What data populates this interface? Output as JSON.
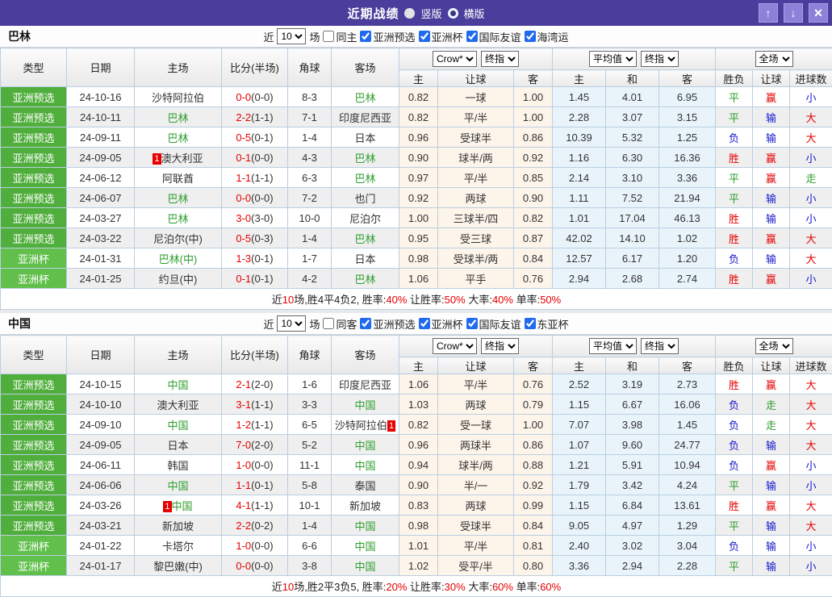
{
  "titlebar": {
    "title": "近期战绩",
    "vertical_label": "竖版",
    "horizontal_label": "横版",
    "up_icon": "↑",
    "down_icon": "↓",
    "close_icon": "✕"
  },
  "filter_labels": {
    "near": "近",
    "matches": "场"
  },
  "table_header": {
    "static_cols": [
      "类型",
      "日期",
      "主场",
      "比分(半场)",
      "角球",
      "客场"
    ],
    "group1_selects": [
      "Crow*",
      "终指"
    ],
    "group1_cols": [
      "主",
      "让球",
      "客"
    ],
    "group2_selects": [
      "平均值",
      "终指"
    ],
    "group2_cols": [
      "主",
      "和",
      "客"
    ],
    "group3_select": "全场",
    "group3_cols": [
      "胜负",
      "让球",
      "进球数"
    ]
  },
  "colors": {
    "titlebar_purple": "#4a3e9c",
    "type_green": "#50ae3c",
    "win_red": "#e60000",
    "loss_blue": "#1717cd",
    "draw_green": "#2e9e2e",
    "checkbox_blue": "#1f6bf0"
  },
  "sections": [
    {
      "team": "巴林",
      "filter": {
        "count": "10",
        "same": "同主",
        "same_checked": false,
        "competitions": [
          "亚洲预选",
          "亚洲杯",
          "国际友谊",
          "海湾运"
        ]
      },
      "rows": [
        {
          "type": "亚洲预选",
          "date": "24-10-16",
          "home": "沙特阿拉伯",
          "home_green": false,
          "score": "0-0",
          "half": "(0-0)",
          "corner": "8-3",
          "away": "巴林",
          "away_green": true,
          "odds1": [
            "0.82",
            "一球",
            "1.00"
          ],
          "odds2": [
            "1.45",
            "4.01",
            "6.95"
          ],
          "results": [
            "平",
            "赢",
            "小"
          ]
        },
        {
          "type": "亚洲预选",
          "date": "24-10-11",
          "home": "巴林",
          "home_green": true,
          "score": "2-2",
          "half": "(1-1)",
          "corner": "7-1",
          "away": "印度尼西亚",
          "away_green": false,
          "odds1": [
            "0.82",
            "平/半",
            "1.00"
          ],
          "odds2": [
            "2.28",
            "3.07",
            "3.15"
          ],
          "results": [
            "平",
            "输",
            "大"
          ]
        },
        {
          "type": "亚洲预选",
          "date": "24-09-11",
          "home": "巴林",
          "home_green": true,
          "score": "0-5",
          "half": "(0-1)",
          "corner": "1-4",
          "away": "日本",
          "away_green": false,
          "odds1": [
            "0.96",
            "受球半",
            "0.86"
          ],
          "odds2": [
            "10.39",
            "5.32",
            "1.25"
          ],
          "results": [
            "负",
            "输",
            "大"
          ]
        },
        {
          "type": "亚洲预选",
          "date": "24-09-05",
          "home": "澳大利亚",
          "home_green": false,
          "home_badge": "1",
          "score": "0-1",
          "half": "(0-0)",
          "corner": "4-3",
          "away": "巴林",
          "away_green": true,
          "odds1": [
            "0.90",
            "球半/两",
            "0.92"
          ],
          "odds2": [
            "1.16",
            "6.30",
            "16.36"
          ],
          "results": [
            "胜",
            "赢",
            "小"
          ]
        },
        {
          "type": "亚洲预选",
          "date": "24-06-12",
          "home": "阿联酋",
          "home_green": false,
          "score": "1-1",
          "half": "(1-1)",
          "corner": "6-3",
          "away": "巴林",
          "away_green": true,
          "odds1": [
            "0.97",
            "平/半",
            "0.85"
          ],
          "odds2": [
            "2.14",
            "3.10",
            "3.36"
          ],
          "results": [
            "平",
            "赢",
            "走"
          ]
        },
        {
          "type": "亚洲预选",
          "date": "24-06-07",
          "home": "巴林",
          "home_green": true,
          "score": "0-0",
          "half": "(0-0)",
          "corner": "7-2",
          "away": "也门",
          "away_green": false,
          "odds1": [
            "0.92",
            "两球",
            "0.90"
          ],
          "odds2": [
            "1.11",
            "7.52",
            "21.94"
          ],
          "results": [
            "平",
            "输",
            "小"
          ]
        },
        {
          "type": "亚洲预选",
          "date": "24-03-27",
          "home": "巴林",
          "home_green": true,
          "score": "3-0",
          "half": "(3-0)",
          "corner": "10-0",
          "away": "尼泊尔",
          "away_green": false,
          "odds1": [
            "1.00",
            "三球半/四",
            "0.82"
          ],
          "odds2": [
            "1.01",
            "17.04",
            "46.13"
          ],
          "results": [
            "胜",
            "输",
            "小"
          ]
        },
        {
          "type": "亚洲预选",
          "date": "24-03-22",
          "home": "尼泊尔(中)",
          "home_green": false,
          "score": "0-5",
          "half": "(0-3)",
          "corner": "1-4",
          "away": "巴林",
          "away_green": true,
          "odds1": [
            "0.95",
            "受三球",
            "0.87"
          ],
          "odds2": [
            "42.02",
            "14.10",
            "1.02"
          ],
          "results": [
            "胜",
            "赢",
            "大"
          ]
        },
        {
          "type": "亚洲杯",
          "date": "24-01-31",
          "home": "巴林(中)",
          "home_green": true,
          "score": "1-3",
          "half": "(0-1)",
          "corner": "1-7",
          "away": "日本",
          "away_green": false,
          "odds1": [
            "0.98",
            "受球半/两",
            "0.84"
          ],
          "odds2": [
            "12.57",
            "6.17",
            "1.20"
          ],
          "results": [
            "负",
            "输",
            "大"
          ]
        },
        {
          "type": "亚洲杯",
          "date": "24-01-25",
          "home": "约旦(中)",
          "home_green": false,
          "score": "0-1",
          "half": "(0-1)",
          "corner": "4-2",
          "away": "巴林",
          "away_green": true,
          "odds1": [
            "1.06",
            "平手",
            "0.76"
          ],
          "odds2": [
            "2.94",
            "2.68",
            "2.74"
          ],
          "results": [
            "胜",
            "赢",
            "小"
          ]
        }
      ],
      "summary": [
        [
          "近",
          false
        ],
        [
          "10",
          true
        ],
        [
          "场,胜4平4负2, 胜率:",
          false
        ],
        [
          "40%",
          true
        ],
        [
          " 让胜率:",
          false
        ],
        [
          "50%",
          true
        ],
        [
          " 大率:",
          false
        ],
        [
          "40%",
          true
        ],
        [
          " 单率:",
          false
        ],
        [
          "50%",
          true
        ]
      ]
    },
    {
      "team": "中国",
      "filter": {
        "count": "10",
        "same": "同客",
        "same_checked": false,
        "competitions": [
          "亚洲预选",
          "亚洲杯",
          "国际友谊",
          "东亚杯"
        ]
      },
      "rows": [
        {
          "type": "亚洲预选",
          "date": "24-10-15",
          "home": "中国",
          "home_green": true,
          "score": "2-1",
          "half": "(2-0)",
          "corner": "1-6",
          "away": "印度尼西亚",
          "away_green": false,
          "odds1": [
            "1.06",
            "平/半",
            "0.76"
          ],
          "odds2": [
            "2.52",
            "3.19",
            "2.73"
          ],
          "results": [
            "胜",
            "赢",
            "大"
          ]
        },
        {
          "type": "亚洲预选",
          "date": "24-10-10",
          "home": "澳大利亚",
          "home_green": false,
          "score": "3-1",
          "half": "(1-1)",
          "corner": "3-3",
          "away": "中国",
          "away_green": true,
          "odds1": [
            "1.03",
            "两球",
            "0.79"
          ],
          "odds2": [
            "1.15",
            "6.67",
            "16.06"
          ],
          "results": [
            "负",
            "走",
            "大"
          ]
        },
        {
          "type": "亚洲预选",
          "date": "24-09-10",
          "home": "中国",
          "home_green": true,
          "score": "1-2",
          "half": "(1-1)",
          "corner": "6-5",
          "away": "沙特阿拉伯",
          "away_green": false,
          "away_badge": "1",
          "odds1": [
            "0.82",
            "受一球",
            "1.00"
          ],
          "odds2": [
            "7.07",
            "3.98",
            "1.45"
          ],
          "results": [
            "负",
            "走",
            "大"
          ]
        },
        {
          "type": "亚洲预选",
          "date": "24-09-05",
          "home": "日本",
          "home_green": false,
          "score": "7-0",
          "half": "(2-0)",
          "corner": "5-2",
          "away": "中国",
          "away_green": true,
          "odds1": [
            "0.96",
            "两球半",
            "0.86"
          ],
          "odds2": [
            "1.07",
            "9.60",
            "24.77"
          ],
          "results": [
            "负",
            "输",
            "大"
          ]
        },
        {
          "type": "亚洲预选",
          "date": "24-06-11",
          "home": "韩国",
          "home_green": false,
          "score": "1-0",
          "half": "(0-0)",
          "corner": "11-1",
          "away": "中国",
          "away_green": true,
          "odds1": [
            "0.94",
            "球半/两",
            "0.88"
          ],
          "odds2": [
            "1.21",
            "5.91",
            "10.94"
          ],
          "results": [
            "负",
            "赢",
            "小"
          ]
        },
        {
          "type": "亚洲预选",
          "date": "24-06-06",
          "home": "中国",
          "home_green": true,
          "score": "1-1",
          "half": "(0-1)",
          "corner": "5-8",
          "away": "泰国",
          "away_green": false,
          "odds1": [
            "0.90",
            "半/一",
            "0.92"
          ],
          "odds2": [
            "1.79",
            "3.42",
            "4.24"
          ],
          "results": [
            "平",
            "输",
            "小"
          ]
        },
        {
          "type": "亚洲预选",
          "date": "24-03-26",
          "home": "中国",
          "home_green": true,
          "home_badge": "1",
          "score": "4-1",
          "half": "(1-1)",
          "corner": "10-1",
          "away": "新加坡",
          "away_green": false,
          "odds1": [
            "0.83",
            "两球",
            "0.99"
          ],
          "odds2": [
            "1.15",
            "6.84",
            "13.61"
          ],
          "results": [
            "胜",
            "赢",
            "大"
          ]
        },
        {
          "type": "亚洲预选",
          "date": "24-03-21",
          "home": "新加坡",
          "home_green": false,
          "score": "2-2",
          "half": "(0-2)",
          "corner": "1-4",
          "away": "中国",
          "away_green": true,
          "odds1": [
            "0.98",
            "受球半",
            "0.84"
          ],
          "odds2": [
            "9.05",
            "4.97",
            "1.29"
          ],
          "results": [
            "平",
            "输",
            "大"
          ]
        },
        {
          "type": "亚洲杯",
          "date": "24-01-22",
          "home": "卡塔尔",
          "home_green": false,
          "score": "1-0",
          "half": "(0-0)",
          "corner": "6-6",
          "away": "中国",
          "away_green": true,
          "odds1": [
            "1.01",
            "平/半",
            "0.81"
          ],
          "odds2": [
            "2.40",
            "3.02",
            "3.04"
          ],
          "results": [
            "负",
            "输",
            "小"
          ]
        },
        {
          "type": "亚洲杯",
          "date": "24-01-17",
          "home": "黎巴嫩(中)",
          "home_green": false,
          "score": "0-0",
          "half": "(0-0)",
          "corner": "3-8",
          "away": "中国",
          "away_green": true,
          "odds1": [
            "1.02",
            "受平/半",
            "0.80"
          ],
          "odds2": [
            "3.36",
            "2.94",
            "2.28"
          ],
          "results": [
            "平",
            "输",
            "小"
          ]
        }
      ],
      "summary": [
        [
          "近",
          false
        ],
        [
          "10",
          true
        ],
        [
          "场,胜2平3负5, 胜率:",
          false
        ],
        [
          "20%",
          true
        ],
        [
          " 让胜率:",
          false
        ],
        [
          "30%",
          true
        ],
        [
          " 大率:",
          false
        ],
        [
          "60%",
          true
        ],
        [
          " 单率:",
          false
        ],
        [
          "60%",
          true
        ]
      ]
    }
  ]
}
